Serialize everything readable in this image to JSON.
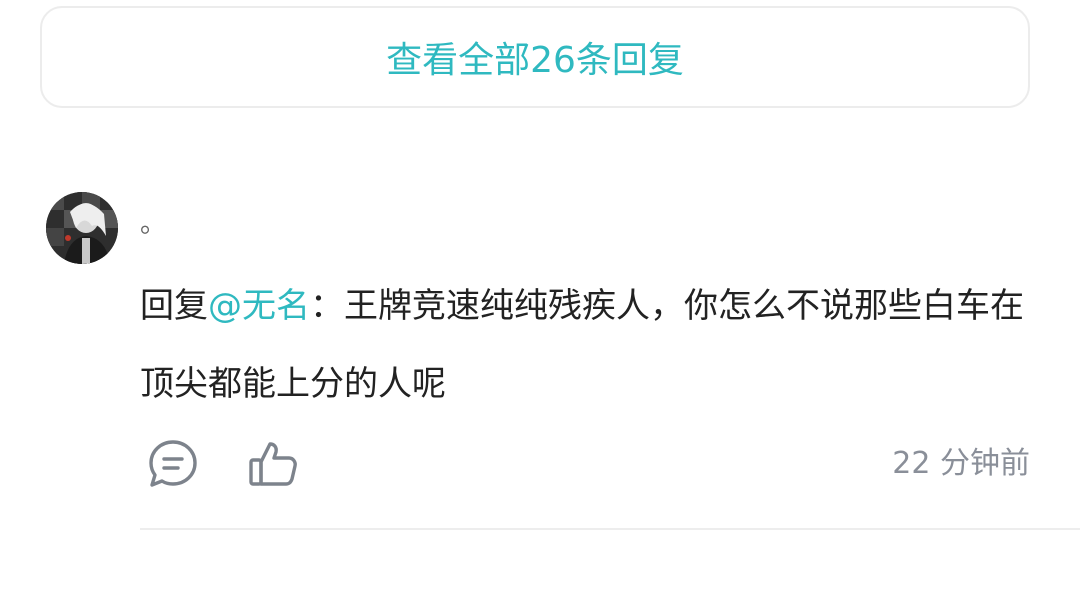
{
  "replies": {
    "view_all_label": "查看全部26条回复"
  },
  "comment": {
    "username": "。",
    "reply_prefix": "回复",
    "mention": "@无名",
    "separator": "：",
    "text": "王牌竞速纯纯残疾人，你怎么不说那些白车在顶尖都能上分的人呢",
    "timestamp": "22 分钟前",
    "icons": {
      "reply": "comment-icon",
      "like": "thumbs-up-icon"
    }
  },
  "colors": {
    "accent": "#2fb9c0",
    "text": "#222222",
    "muted": "#8a8f99",
    "icon": "#7d838c"
  }
}
